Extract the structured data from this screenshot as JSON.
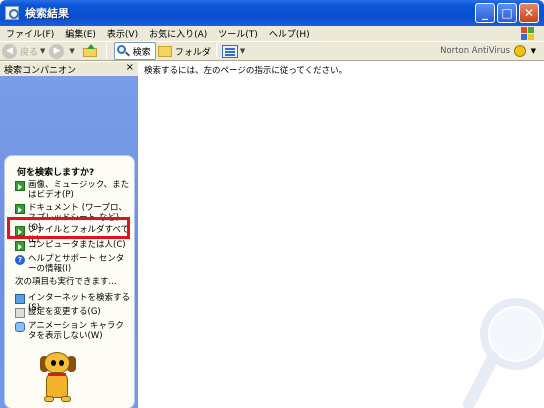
{
  "window": {
    "title": "検索結果",
    "controls": {
      "minimize": "_",
      "maximize": "□",
      "close": "✕"
    }
  },
  "menu": [
    "ファイル(F)",
    "編集(E)",
    "表示(V)",
    "お気に入り(A)",
    "ツール(T)",
    "ヘルプ(H)"
  ],
  "toolbar": {
    "back": "戻る",
    "search": "検索",
    "folders": "フォルダ",
    "norton": "Norton AntiVirus"
  },
  "left_pane": {
    "header": "検索コンパニオン",
    "close": "×",
    "question": "何を検索しますか?",
    "options": [
      {
        "label": "画像、ミュージック、またはビデオ(P)",
        "icon": "arrow-icon"
      },
      {
        "label": "ドキュメント (ワープロ、スプレッドシート など)(O)",
        "icon": "arrow-icon"
      },
      {
        "label": "ファイルとフォルダすべて(L)",
        "icon": "arrow-icon"
      },
      {
        "label": "コンピュータまたは人(C)",
        "icon": "arrow-icon"
      },
      {
        "label": "ヘルプとサポート センターの情報(I)",
        "icon": "help-icon"
      }
    ],
    "also_heading": "次の項目も実行できます...",
    "also_options": [
      {
        "label": "インターネットを検索する(S)",
        "icon": "globe-icon"
      },
      {
        "label": "設定を変更する(G)",
        "icon": "settings-icon"
      },
      {
        "label": "アニメーション キャラクタを表示しない(W)",
        "icon": "char-icon"
      }
    ]
  },
  "right_pane": {
    "instruction": "検索するには、左のページの指示に従ってください。"
  },
  "colors": {
    "highlight": "#e0121b",
    "pane_blue": "#7a9ee8",
    "title_blue": "#0a56d8"
  }
}
